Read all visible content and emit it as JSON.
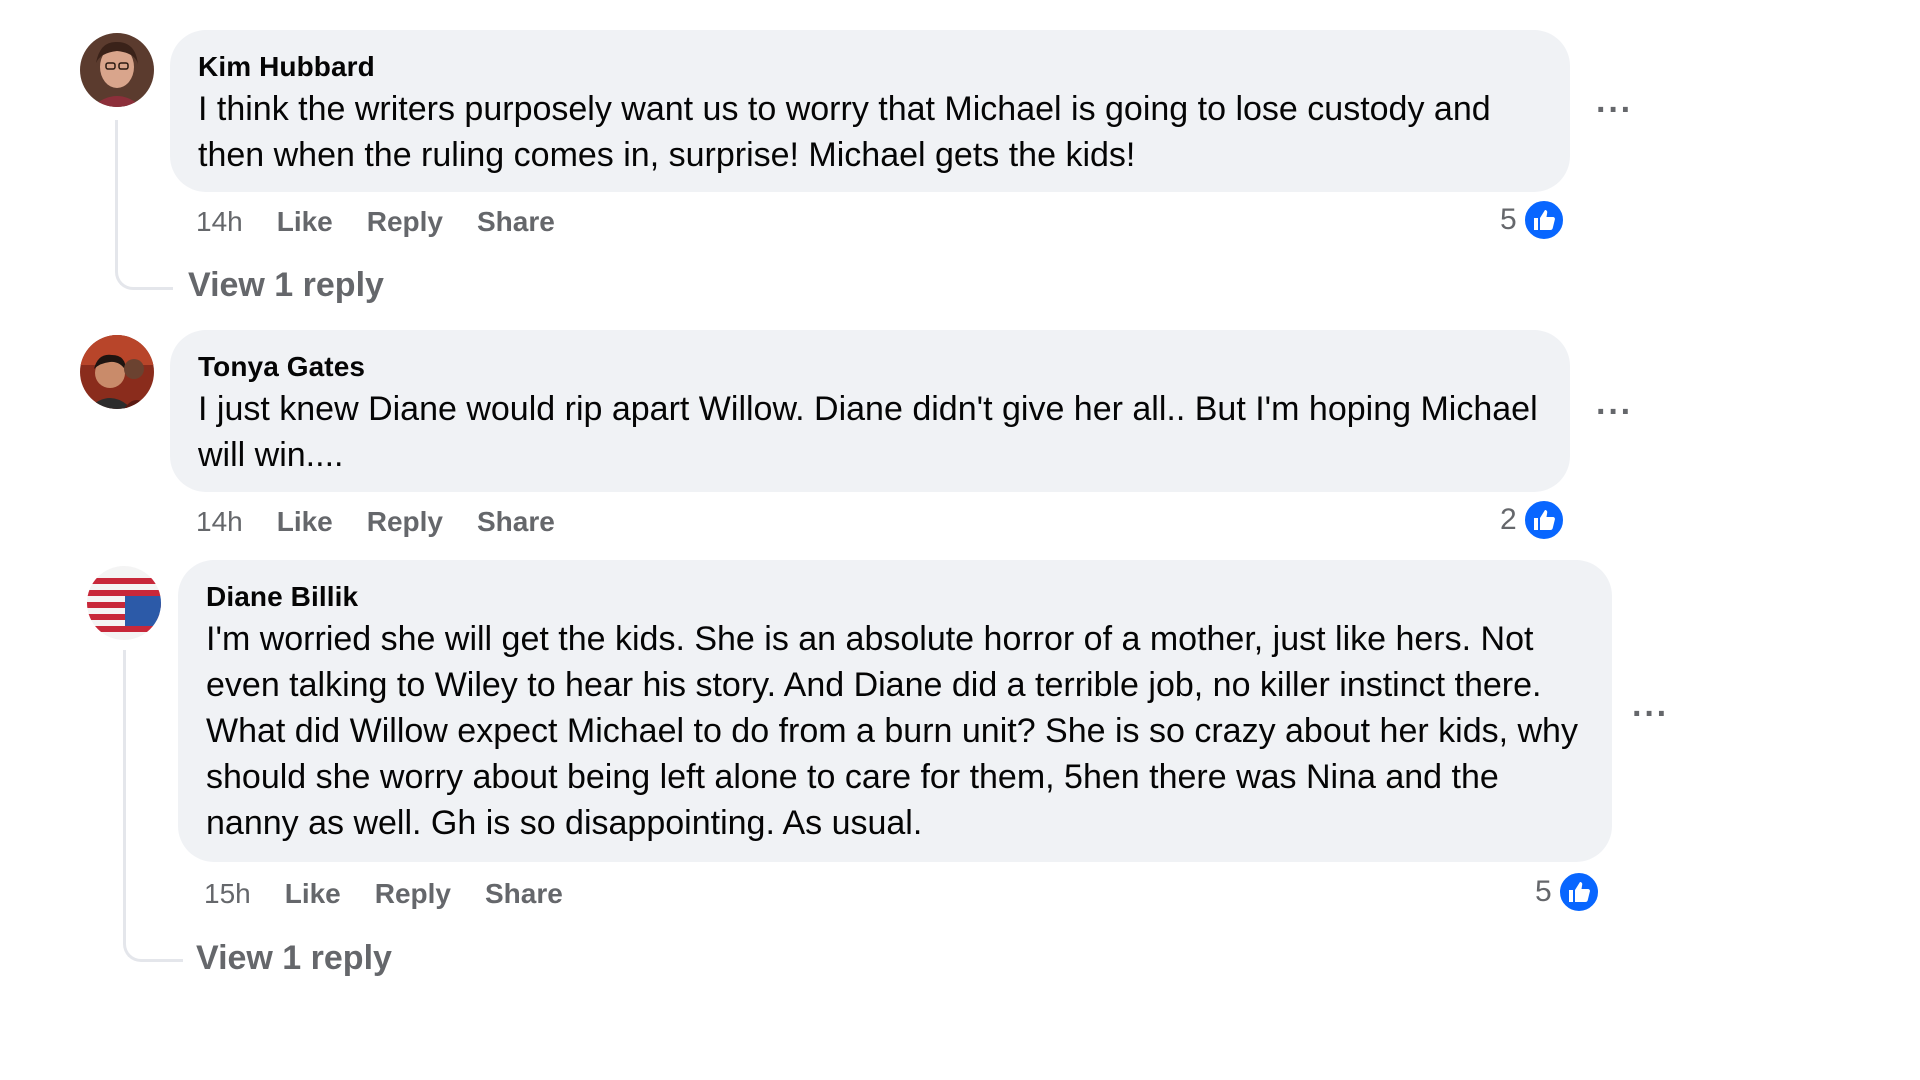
{
  "comments": [
    {
      "author": "Kim Hubbard",
      "text": "I think the writers purposely want us to worry that Michael is going to lose custody and then when the ruling comes in, surprise! Michael gets the kids!",
      "time": "14h",
      "like_label": "Like",
      "reply_label": "Reply",
      "share_label": "Share",
      "reaction_count": "5",
      "view_replies": "View 1 reply",
      "more_label": "···"
    },
    {
      "author": "Tonya Gates",
      "text": "I just knew Diane would rip apart Willow. Diane didn't give her all.. But I'm hoping Michael will win....",
      "time": "14h",
      "like_label": "Like",
      "reply_label": "Reply",
      "share_label": "Share",
      "reaction_count": "2",
      "more_label": "···"
    },
    {
      "author": "Diane Billik",
      "text": "I'm worried she will get the kids. She is an absolute horror of a mother, just like hers. Not even talking to Wiley to hear his story. And Diane did a terrible job, no killer instinct there. What did Willow expect Michael to do from a burn unit? She is so crazy about her kids, why should she worry about being left alone to care for them, 5hen there was Nina and the nanny as well. Gh is so disappointing. As usual.",
      "time": "15h",
      "like_label": "Like",
      "reply_label": "Reply",
      "share_label": "Share",
      "reaction_count": "5",
      "view_replies": "View 1 reply",
      "more_label": "···"
    }
  ],
  "colors": {
    "bubble": "#f0f2f5",
    "secondary_text": "#65676b",
    "like_blue": "#0866ff"
  }
}
